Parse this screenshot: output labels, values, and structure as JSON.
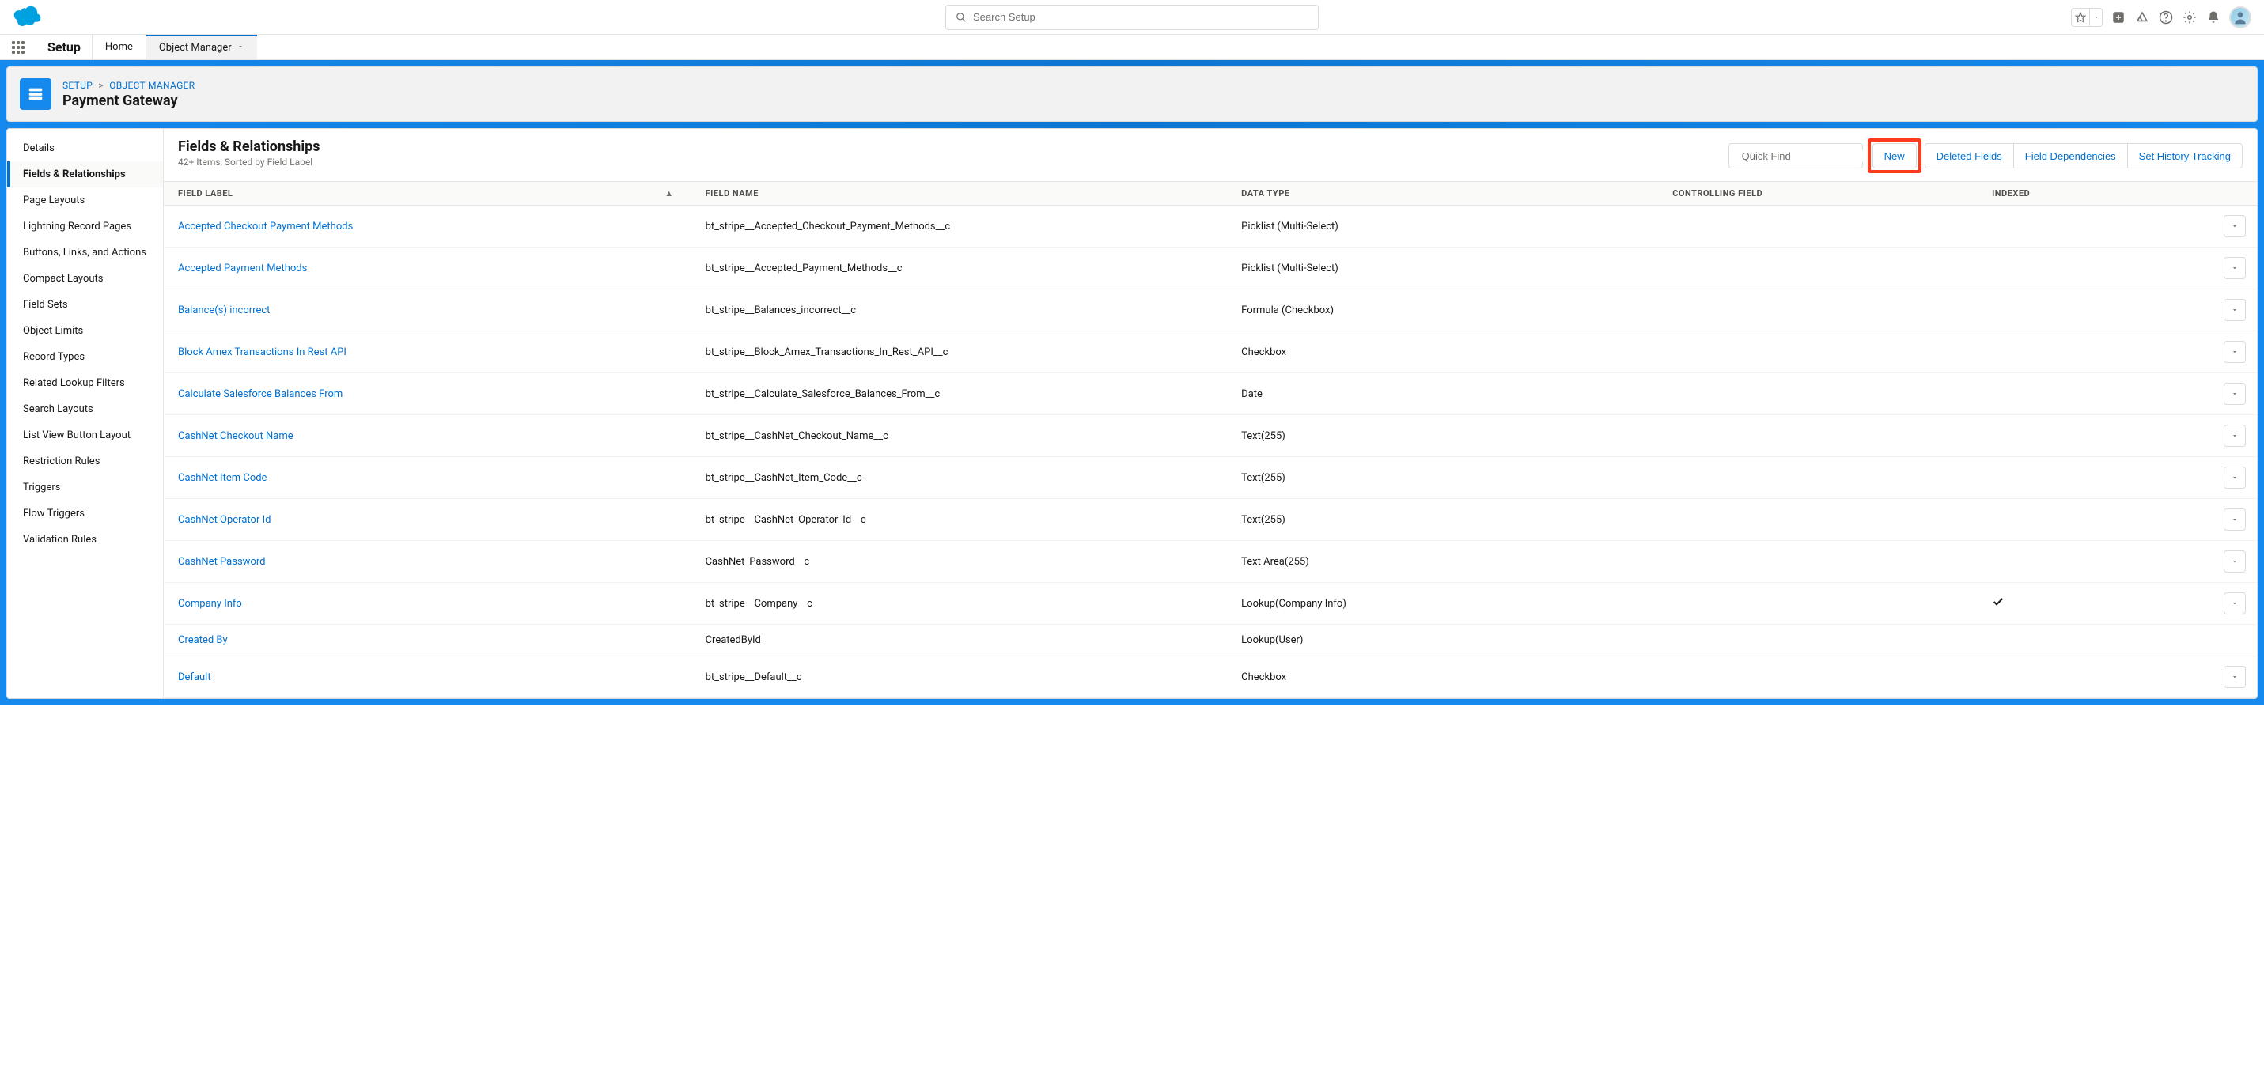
{
  "header": {
    "search_placeholder": "Search Setup"
  },
  "nav": {
    "app_name": "Setup",
    "home": "Home",
    "object_manager": "Object Manager"
  },
  "page": {
    "breadcrumb_setup": "SETUP",
    "breadcrumb_om": "OBJECT MANAGER",
    "title": "Payment Gateway"
  },
  "sidebar": {
    "items": [
      "Details",
      "Fields & Relationships",
      "Page Layouts",
      "Lightning Record Pages",
      "Buttons, Links, and Actions",
      "Compact Layouts",
      "Field Sets",
      "Object Limits",
      "Record Types",
      "Related Lookup Filters",
      "Search Layouts",
      "List View Button Layout",
      "Restriction Rules",
      "Triggers",
      "Flow Triggers",
      "Validation Rules"
    ],
    "active_index": 1
  },
  "main": {
    "title": "Fields & Relationships",
    "subtitle": "42+ Items, Sorted by Field Label",
    "quick_find_placeholder": "Quick Find",
    "buttons": {
      "new": "New",
      "deleted": "Deleted Fields",
      "deps": "Field Dependencies",
      "history": "Set History Tracking"
    },
    "columns": {
      "label": "FIELD LABEL",
      "name": "FIELD NAME",
      "type": "DATA TYPE",
      "ctrl": "CONTROLLING FIELD",
      "idx": "INDEXED"
    },
    "rows": [
      {
        "label": "Accepted Checkout Payment Methods",
        "name": "bt_stripe__Accepted_Checkout_Payment_Methods__c",
        "type": "Picklist (Multi-Select)",
        "ctrl": "",
        "idx": false
      },
      {
        "label": "Accepted Payment Methods",
        "name": "bt_stripe__Accepted_Payment_Methods__c",
        "type": "Picklist (Multi-Select)",
        "ctrl": "",
        "idx": false
      },
      {
        "label": "Balance(s) incorrect",
        "name": "bt_stripe__Balances_incorrect__c",
        "type": "Formula (Checkbox)",
        "ctrl": "",
        "idx": false
      },
      {
        "label": "Block Amex Transactions In Rest API",
        "name": "bt_stripe__Block_Amex_Transactions_In_Rest_API__c",
        "type": "Checkbox",
        "ctrl": "",
        "idx": false
      },
      {
        "label": "Calculate Salesforce Balances From",
        "name": "bt_stripe__Calculate_Salesforce_Balances_From__c",
        "type": "Date",
        "ctrl": "",
        "idx": false
      },
      {
        "label": "CashNet Checkout Name",
        "name": "bt_stripe__CashNet_Checkout_Name__c",
        "type": "Text(255)",
        "ctrl": "",
        "idx": false
      },
      {
        "label": "CashNet Item Code",
        "name": "bt_stripe__CashNet_Item_Code__c",
        "type": "Text(255)",
        "ctrl": "",
        "idx": false
      },
      {
        "label": "CashNet Operator Id",
        "name": "bt_stripe__CashNet_Operator_Id__c",
        "type": "Text(255)",
        "ctrl": "",
        "idx": false
      },
      {
        "label": "CashNet Password",
        "name": "CashNet_Password__c",
        "type": "Text Area(255)",
        "ctrl": "",
        "idx": false
      },
      {
        "label": "Company Info",
        "name": "bt_stripe__Company__c",
        "type": "Lookup(Company Info)",
        "ctrl": "",
        "idx": true
      },
      {
        "label": "Created By",
        "name": "CreatedById",
        "type": "Lookup(User)",
        "ctrl": "",
        "idx": false,
        "no_action": true
      },
      {
        "label": "Default",
        "name": "bt_stripe__Default__c",
        "type": "Checkbox",
        "ctrl": "",
        "idx": false
      }
    ]
  }
}
